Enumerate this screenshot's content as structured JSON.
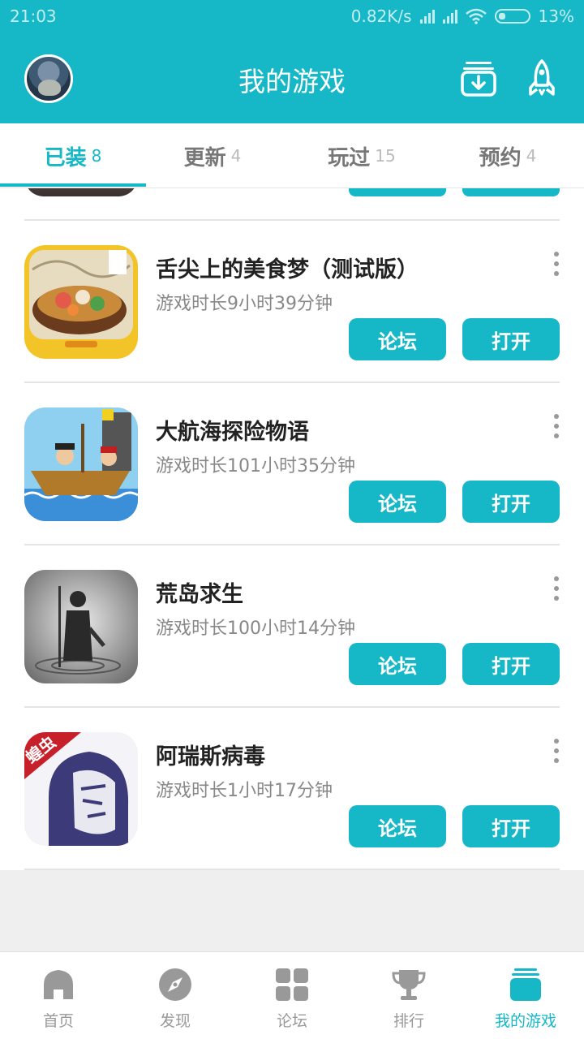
{
  "status_bar": {
    "time": "21:03",
    "net_speed": "0.82K/s",
    "battery": "13%"
  },
  "header": {
    "title": "我的游戏",
    "icons": [
      "avatar",
      "download-icon",
      "rocket-icon"
    ],
    "accent_color": "#16b8c8"
  },
  "tabs": [
    {
      "label": "已装",
      "count": "8",
      "active": true
    },
    {
      "label": "更新",
      "count": "4",
      "active": false
    },
    {
      "label": "玩过",
      "count": "15",
      "active": false
    },
    {
      "label": "预约",
      "count": "4",
      "active": false
    }
  ],
  "games": [
    {
      "name": "舌尖上的美食梦（测试版）",
      "playtime": "游戏时长9小时39分钟",
      "forum_label": "论坛",
      "open_label": "打开",
      "icon": "food-game-icon"
    },
    {
      "name": "大航海探险物语",
      "playtime": "游戏时长101小时35分钟",
      "forum_label": "论坛",
      "open_label": "打开",
      "icon": "pirate-ship-icon"
    },
    {
      "name": "荒岛求生",
      "playtime": "游戏时长100小时14分钟",
      "forum_label": "论坛",
      "open_label": "打开",
      "icon": "survivor-icon"
    },
    {
      "name": "阿瑞斯病毒",
      "playtime": "游戏时长1小时17分钟",
      "forum_label": "论坛",
      "open_label": "打开",
      "icon": "ares-virus-icon",
      "badge": "蝗虫"
    }
  ],
  "bottom_nav": [
    {
      "label": "首页",
      "icon": "home-icon",
      "active": false
    },
    {
      "label": "发现",
      "icon": "compass-icon",
      "active": false
    },
    {
      "label": "论坛",
      "icon": "grid-icon",
      "active": false
    },
    {
      "label": "排行",
      "icon": "trophy-icon",
      "active": false
    },
    {
      "label": "我的游戏",
      "icon": "stack-icon",
      "active": true
    }
  ]
}
